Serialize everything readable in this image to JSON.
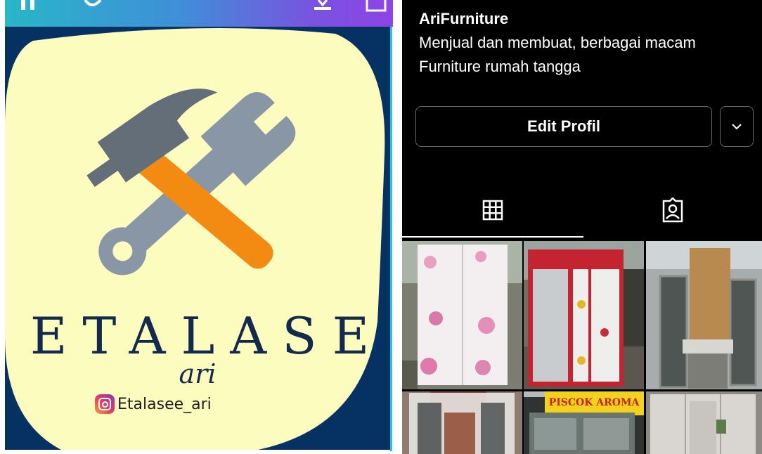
{
  "left_panel": {
    "logo": {
      "title": "ETALASE",
      "subtitle": "ari",
      "instagram_handle": "Etalasee_ari"
    },
    "colors": {
      "background": "#053262",
      "blob": "#fdfcbf",
      "text": "#13294d"
    }
  },
  "profile": {
    "username": "AriFurniture",
    "bio": "Menjual dan membuat, berbagai macam Furniture rumah tangga",
    "edit_button": "Edit Profil"
  },
  "tabs": [
    {
      "icon": "grid-icon",
      "selected": true
    },
    {
      "icon": "tagged-icon",
      "selected": false
    }
  ],
  "posts": [
    {
      "icon": "wardrobe-flowers-photo",
      "sign": ""
    },
    {
      "icon": "red-cabinet-photo",
      "sign": ""
    },
    {
      "icon": "glass-display-photo",
      "sign": ""
    },
    {
      "icon": "white-cabinet-photo",
      "sign": ""
    },
    {
      "icon": "shop-display-photo",
      "sign": "PISCOK AROMA"
    },
    {
      "icon": "wardrobe-photo",
      "sign": ""
    }
  ]
}
